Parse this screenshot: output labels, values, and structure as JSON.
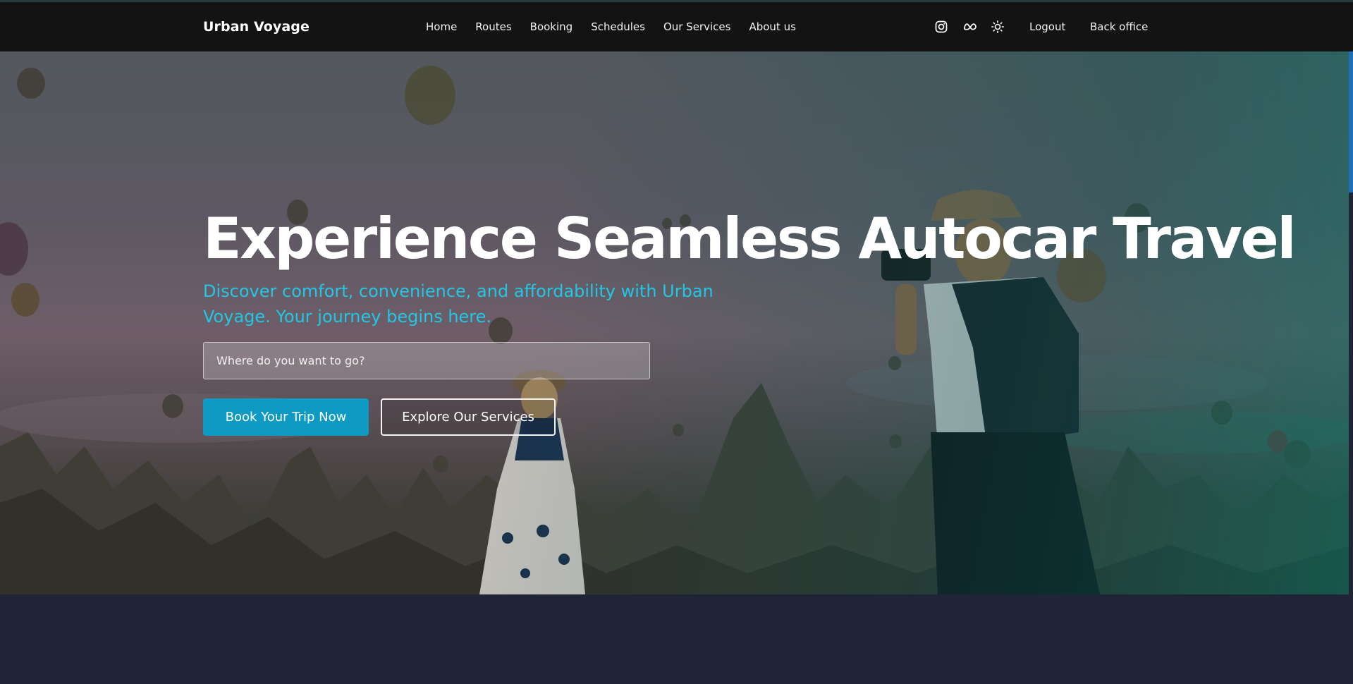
{
  "app": {
    "brand": "Urban Voyage"
  },
  "nav": {
    "links": [
      "Home",
      "Routes",
      "Booking",
      "Schedules",
      "Our Services",
      "About us"
    ],
    "icons": [
      "instagram-icon",
      "meta-icon",
      "sun-icon"
    ],
    "logout": "Logout",
    "back_office": "Back office"
  },
  "hero": {
    "title": "Experience Seamless Autocar Travel",
    "subtitle": "Discover comfort, convenience, and affordability with Urban Voyage. Your journey begins here.",
    "search_placeholder": "Where do you want to go?",
    "search_value": "",
    "primary_button": "Book Your Trip Now",
    "secondary_button": "Explore Our Services"
  },
  "colors": {
    "navbar_bg": "#131313",
    "accent": "#0e9ac2",
    "subtitle": "#22c7e6",
    "footer_bg": "#1f2536"
  }
}
